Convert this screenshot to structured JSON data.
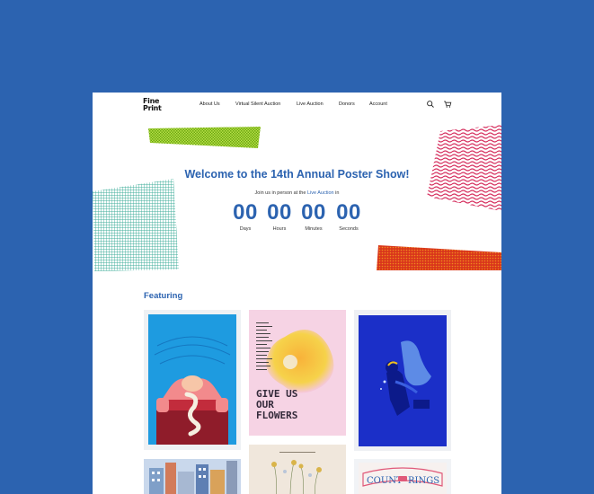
{
  "header": {
    "logo_line1": "Fine",
    "logo_line2": "Print",
    "nav": [
      "About Us",
      "Virtual Silent Auction",
      "Live Auction",
      "Donors",
      "Account"
    ]
  },
  "hero": {
    "title": "Welcome to the 14th Annual Poster Show!",
    "sub_prefix": "Join us in person at the ",
    "sub_link": "Live Auction",
    "sub_suffix": " in",
    "countdown": [
      {
        "value": "00",
        "label": "Days"
      },
      {
        "value": "00",
        "label": "Hours"
      },
      {
        "value": "00",
        "label": "Minutes"
      },
      {
        "value": "00",
        "label": "Seconds"
      }
    ]
  },
  "featuring": {
    "heading": "Featuring",
    "poster2_text": [
      "GIVE US",
      "OUR",
      "FLOWERS"
    ],
    "poster6_text": [
      "COUNT",
      "RINGS"
    ]
  },
  "colors": {
    "background": "#2c63b0",
    "accent": "#2c63b0",
    "green_pattern": "#8fc41e",
    "pink_pattern": "#e23d6e",
    "teal_pattern": "#4fb8a6",
    "red_pattern": "#d9361c"
  },
  "icons": [
    "search-icon",
    "cart-icon"
  ]
}
